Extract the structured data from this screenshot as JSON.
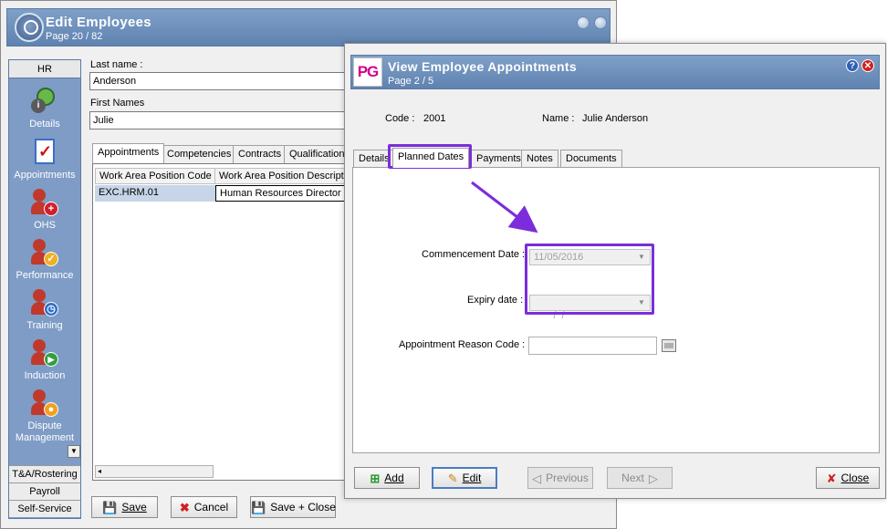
{
  "bg_window": {
    "title": "Edit Employees",
    "subtitle": "Page 20 / 82",
    "sidebar": {
      "header": "HR",
      "items": [
        {
          "label": "Details",
          "icon": "info-person-icon"
        },
        {
          "label": "Appointments",
          "icon": "checklist-icon"
        },
        {
          "label": "OHS",
          "icon": "person-plus-icon"
        },
        {
          "label": "Performance",
          "icon": "person-check-icon"
        },
        {
          "label": "Training",
          "icon": "person-timer-icon"
        },
        {
          "label": "Induction",
          "icon": "person-play-icon"
        },
        {
          "label": "Dispute Management",
          "icon": "person-user-icon"
        }
      ],
      "sections": [
        "T&A/Rostering",
        "Payroll",
        "Self-Service"
      ]
    },
    "last_name_label": "Last name :",
    "last_name_value": "Anderson",
    "first_names_label": "First Names",
    "first_names_value": "Julie",
    "tabs": [
      "Appointments",
      "Competencies",
      "Contracts",
      "Qualification"
    ],
    "grid": {
      "columns": [
        "Work Area Position Code",
        "Work Area Position Description"
      ],
      "rows": [
        [
          "EXC.HRM.01",
          "Human Resources Director"
        ]
      ]
    },
    "buttons": {
      "save": "Save",
      "cancel": "Cancel",
      "save_close": "Save + Close"
    }
  },
  "fg_window": {
    "logo": "PG",
    "title": "View Employee Appointments",
    "subtitle": "Page 2 / 5",
    "code_label": "Code :",
    "code_value": "2001",
    "name_label": "Name :",
    "name_value": "Julie Anderson",
    "tabs": [
      "Details",
      "Planned Dates",
      "Payments",
      "Notes",
      "Documents"
    ],
    "active_tab": "Planned Dates",
    "commencement_label": "Commencement Date :",
    "commencement_value": "11/05/2016",
    "expiry_label": "Expiry date :",
    "expiry_value": " /  / ",
    "reason_label": "Appointment Reason Code :",
    "reason_value": "",
    "buttons": {
      "add": "Add",
      "edit": "Edit",
      "previous": "Previous",
      "next": "Next",
      "close": "Close"
    }
  },
  "colors": {
    "title_bar": "#6f91bd",
    "highlight": "#7b2ddb",
    "sidebar": "#7e9cc6",
    "logo": "#d4008a"
  }
}
